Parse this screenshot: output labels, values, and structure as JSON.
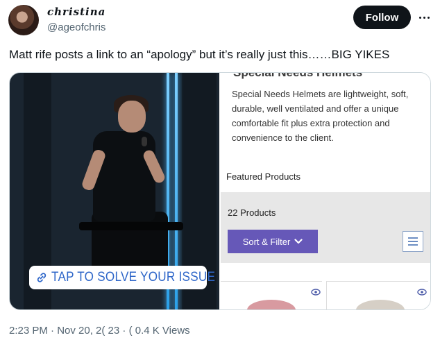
{
  "author": {
    "display_name": "christina",
    "handle": "@ageofchris",
    "avatar_icon": "profile-photo"
  },
  "follow_label": "Follow",
  "more_icon": "ellipsis-icon",
  "tweet_text": "Matt rife posts a link to an “apology” but it’s really just this……BIG YIKES",
  "media": {
    "sticker_text": "TAP TO SOLVE YOUR ISSUE",
    "sticker_icon": "link-icon",
    "shop": {
      "title": "Special Needs Helmets",
      "description": "Special Needs Helmets are lightweight, soft, durable, well ventilated and offer a unique comfortable fit plus extra protection and convenience to the client.",
      "featured_label": "Featured Products",
      "count_label": "22 Products",
      "sort_label": "Sort & Filter",
      "sort_icon": "chevron-down-icon",
      "menu_icon": "hamburger-menu-icon",
      "accent_color": "#6658b8"
    }
  },
  "meta": {
    "timestamp": "2:23 PM · Nov 20, 2( 23 · ( 0.4 K Views"
  }
}
